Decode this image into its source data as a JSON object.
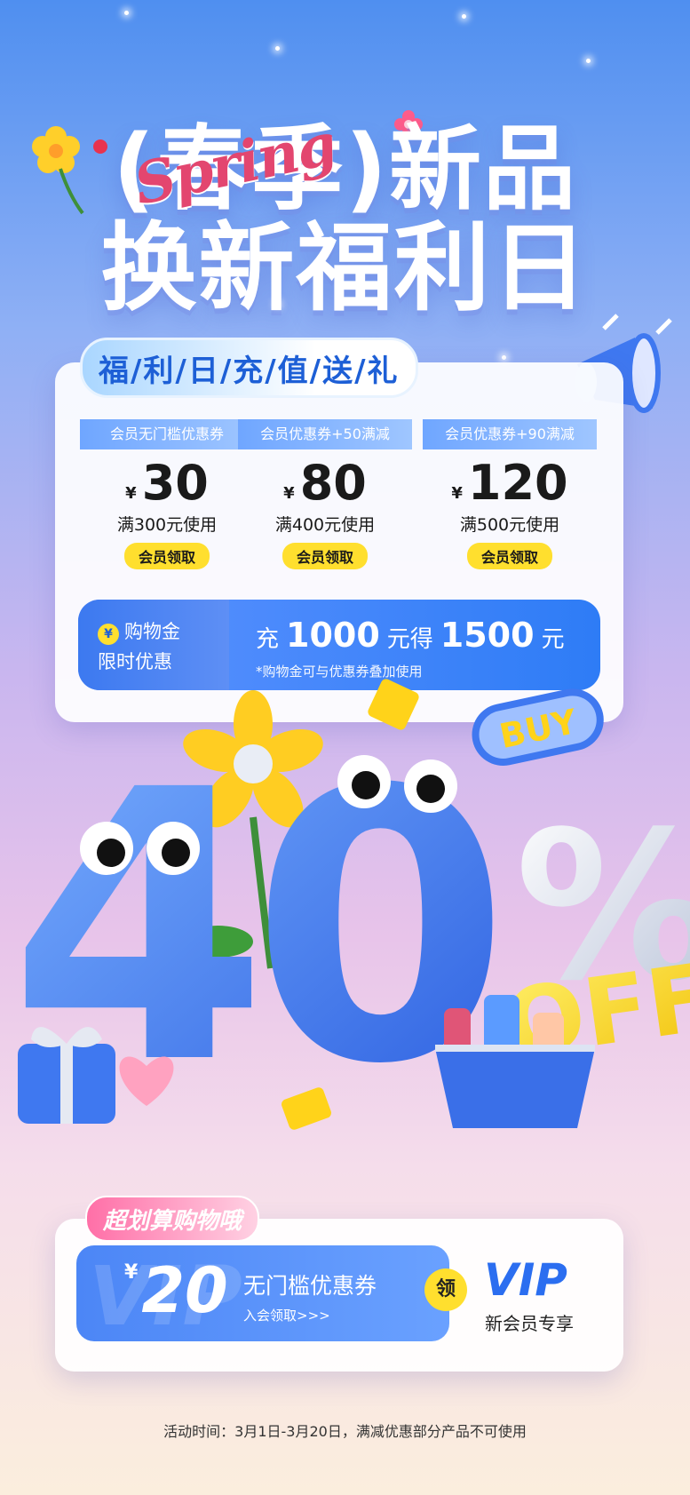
{
  "title": {
    "line1": "(春季)新品",
    "line2": "换新福利日",
    "script": "Spring"
  },
  "benefit_tag": "福/利/日/充/值/送/礼",
  "coupons": [
    {
      "header": "会员无门槛优惠券",
      "currency": "¥",
      "amount": "30",
      "condition": "满300元使用",
      "button": "会员领取"
    },
    {
      "header": "会员优惠券+50满减",
      "currency": "¥",
      "amount": "80",
      "condition": "满400元使用",
      "button": "会员领取"
    },
    {
      "header": "会员优惠券+90满减",
      "currency": "¥",
      "amount": "120",
      "condition": "满500元使用",
      "button": "会员领取"
    }
  ],
  "recharge": {
    "icon_label": "¥",
    "label_line1": "购物金",
    "label_line2": "限时优惠",
    "prefix": "充",
    "pay": "1000",
    "mid": "元得",
    "get": "1500",
    "suffix": "元",
    "note": "*购物金可与优惠券叠加使用"
  },
  "illustration": {
    "big_number": "40",
    "percent": "%",
    "off": "OFF",
    "buy": "BUY"
  },
  "bottom": {
    "tag": "超划算购物哦",
    "watermark": "VIP",
    "currency": "¥",
    "amount": "20",
    "desc": "无门槛优惠券",
    "sub": "入会领取>>>",
    "claim": "领",
    "vip_title": "VIP",
    "vip_sub": "新会员专享"
  },
  "footer": "活动时间：3月1日-3月20日，满减优惠部分产品不可使用",
  "colors": {
    "primary_blue": "#2e7cf6",
    "yellow": "#ffdf2e",
    "pink": "#ff6fa7"
  }
}
